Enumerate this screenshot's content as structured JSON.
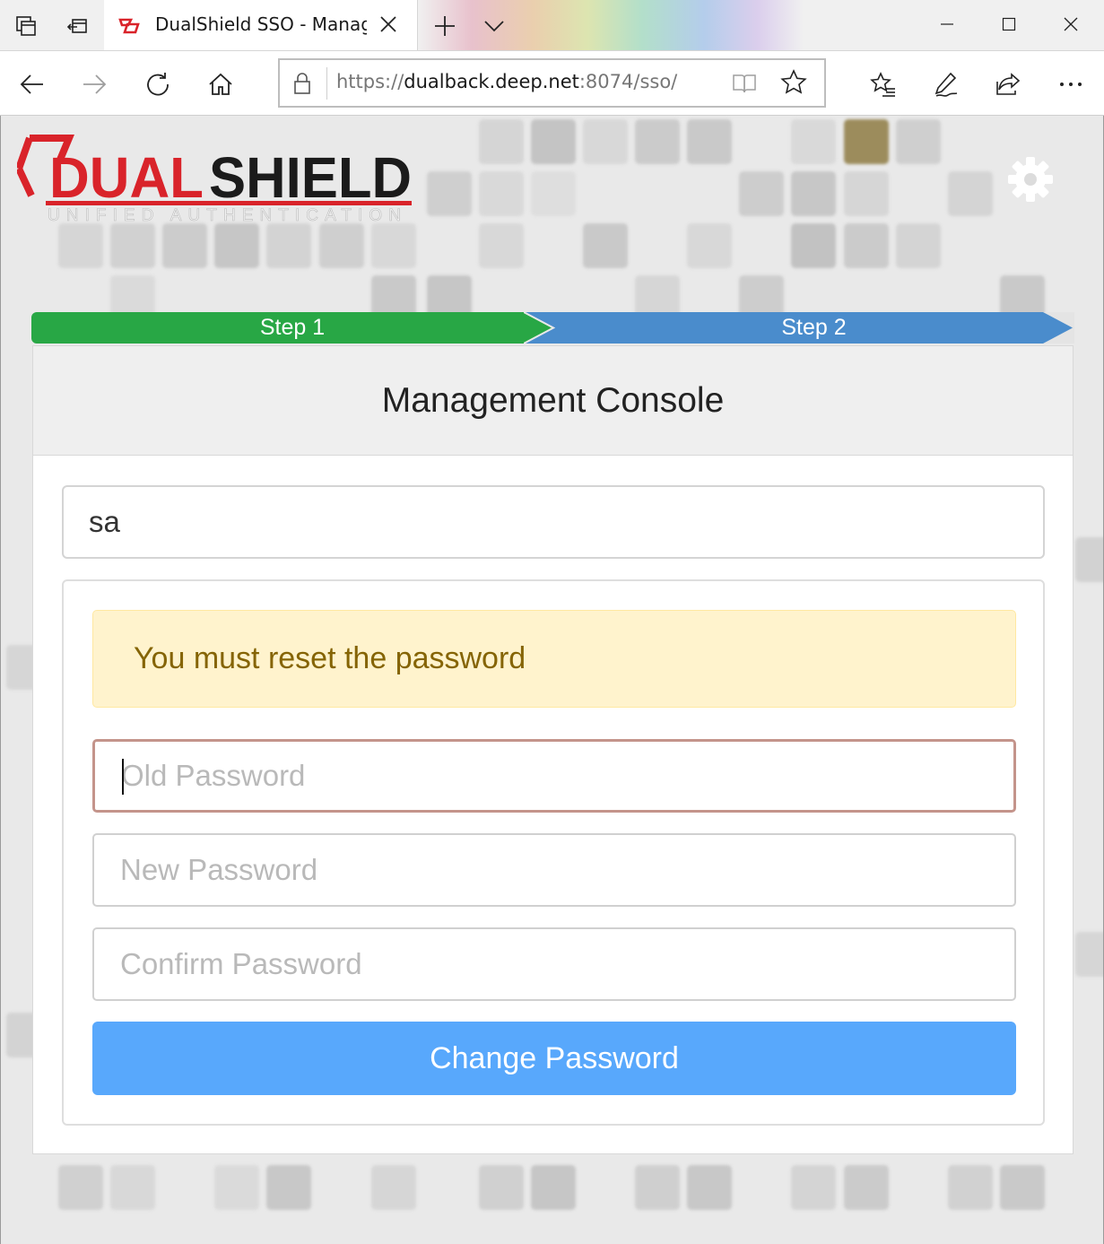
{
  "browser": {
    "tab_title": "DualShield SSO - Manag",
    "url_prefix": "https://",
    "url_host": "dualback.deep.net",
    "url_suffix": ":8074/sso/"
  },
  "page": {
    "logo": {
      "wordmark": "DUALSHIELD",
      "tagline": "UNIFIED AUTHENTICATION",
      "brand_color": "#d9232a"
    },
    "steps": [
      {
        "label": "Step 1",
        "color": "#28a745"
      },
      {
        "label": "Step 2",
        "color": "#4a8ccc"
      }
    ],
    "card_title": "Management Console",
    "username": "sa",
    "alert": "You must reset the password",
    "fields": {
      "old_password_placeholder": "Old Password",
      "new_password_placeholder": "New Password",
      "confirm_password_placeholder": "Confirm Password"
    },
    "submit_label": "Change Password"
  }
}
